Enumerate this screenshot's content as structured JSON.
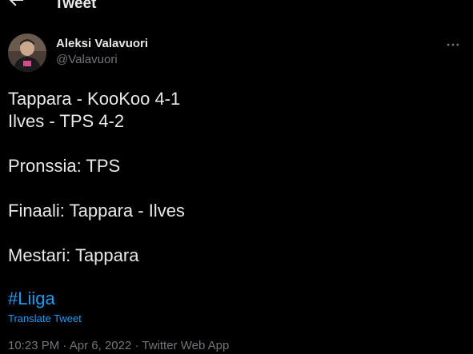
{
  "header": {
    "back_icon": "arrow-left-icon",
    "title": "Tweet"
  },
  "author": {
    "display_name": "Aleksi Valavuori",
    "username": "@Valavuori",
    "more_icon": "more-horizontal-icon"
  },
  "tweet": {
    "lines": [
      "Tappara - KooKoo 4-1",
      "Ilves - TPS 4-2",
      "",
      "Pronssia: TPS",
      "",
      "Finaali: Tappara - Ilves",
      "",
      "Mestari: Tappara"
    ],
    "hashtag": "#Liiga",
    "translate_label": "Translate Tweet",
    "time": "10:23 PM",
    "date": "Apr 6, 2022",
    "source": "Twitter Web App",
    "separator": "·"
  },
  "colors": {
    "background": "#000000",
    "text": "#e7e9ea",
    "secondary": "#71767b",
    "accent": "#1d9bf0"
  }
}
